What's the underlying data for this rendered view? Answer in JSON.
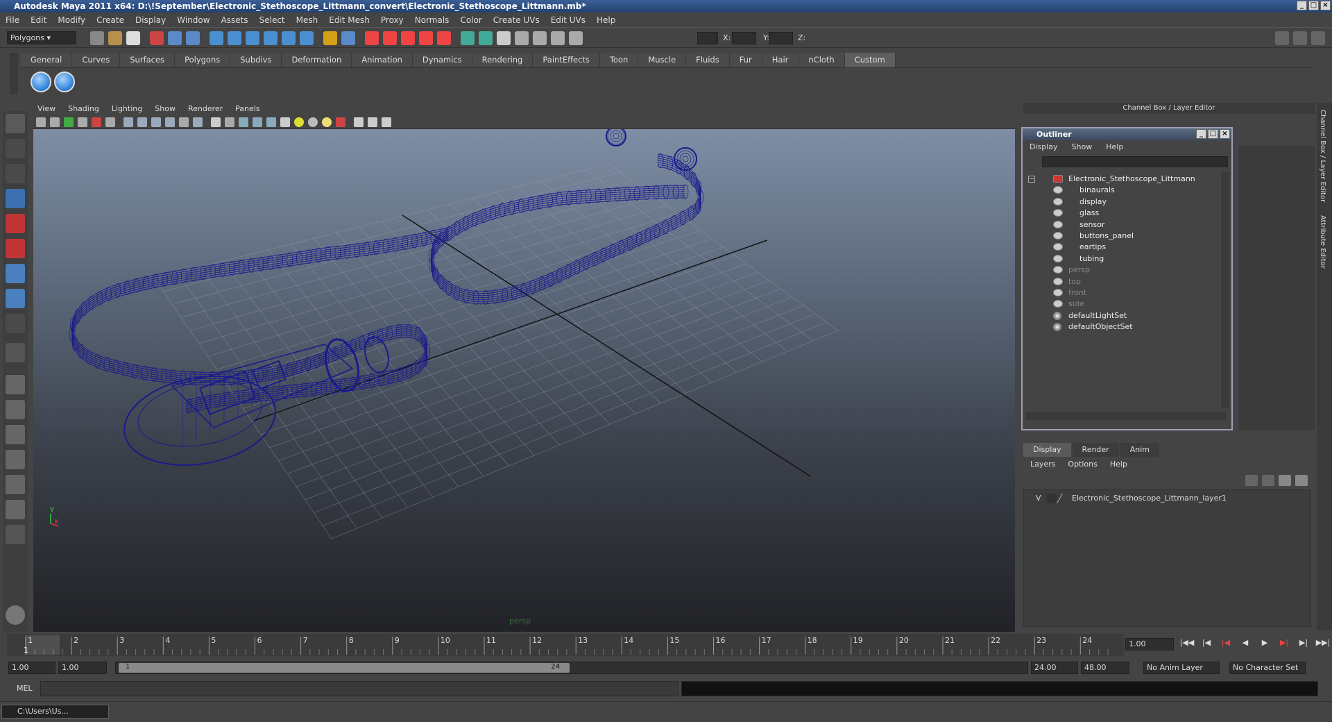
{
  "window": {
    "title": "Autodesk Maya 2011 x64: D:\\!September\\Electronic_Stethoscope_Littmann_convert\\Electronic_Stethoscope_Littmann.mb*"
  },
  "menubar": [
    "File",
    "Edit",
    "Modify",
    "Create",
    "Display",
    "Window",
    "Assets",
    "Select",
    "Mesh",
    "Edit Mesh",
    "Proxy",
    "Normals",
    "Color",
    "Create UVs",
    "Edit UVs",
    "Help"
  ],
  "status": {
    "mode": "Polygons",
    "x_label": "X:",
    "y_label": "Y:",
    "z_label": "Z:"
  },
  "shelf_tabs": [
    "General",
    "Curves",
    "Surfaces",
    "Polygons",
    "Subdivs",
    "Deformation",
    "Animation",
    "Dynamics",
    "Rendering",
    "PaintEffects",
    "Toon",
    "Muscle",
    "Fluids",
    "Fur",
    "Hair",
    "nCloth",
    "Custom"
  ],
  "shelf_active": "Custom",
  "viewport": {
    "menu": [
      "View",
      "Shading",
      "Lighting",
      "Show",
      "Renderer",
      "Panels"
    ],
    "camera_label": "persp",
    "axis_y": "y",
    "axis_x": "x",
    "mesh_color": "#1a1a8c"
  },
  "channel_box": {
    "header": "Channel Box / Layer Editor"
  },
  "outliner": {
    "title": "Outliner",
    "menu": [
      "Display",
      "Show",
      "Help"
    ],
    "root": "Electronic_Stethoscope_Littmann",
    "children": [
      "binaurals",
      "display",
      "glass",
      "sensor",
      "buttons_panel",
      "eartips",
      "tubing"
    ],
    "cameras": [
      "persp",
      "top",
      "front",
      "side"
    ],
    "sets": [
      "defaultLightSet",
      "defaultObjectSet"
    ]
  },
  "layer_editor": {
    "tabs": [
      "Display",
      "Render",
      "Anim"
    ],
    "menu": [
      "Layers",
      "Options",
      "Help"
    ],
    "visibility": "V",
    "layer_name": "Electronic_Stethoscope_Littmann_layer1"
  },
  "timeline": {
    "ticks": [
      "1",
      "2",
      "3",
      "4",
      "5",
      "6",
      "7",
      "8",
      "9",
      "10",
      "11",
      "12",
      "13",
      "14",
      "15",
      "16",
      "17",
      "18",
      "19",
      "20",
      "21",
      "22",
      "23",
      "24"
    ],
    "current_frame": "1",
    "current_time_field": "1.00"
  },
  "range": {
    "start": "1.00",
    "playback_start": "1.00",
    "slider_start": "1",
    "slider_end": "24",
    "playback_end": "24.00",
    "end": "48.00",
    "anim_layer": "No Anim Layer",
    "character_set": "No Character Set"
  },
  "command_line": {
    "label": "MEL"
  },
  "taskbar": {
    "item": "C:\\Users\\Us..."
  },
  "right_strip": {
    "tab1": "Channel Box / Layer Editor",
    "tab2": "Attribute Editor"
  }
}
